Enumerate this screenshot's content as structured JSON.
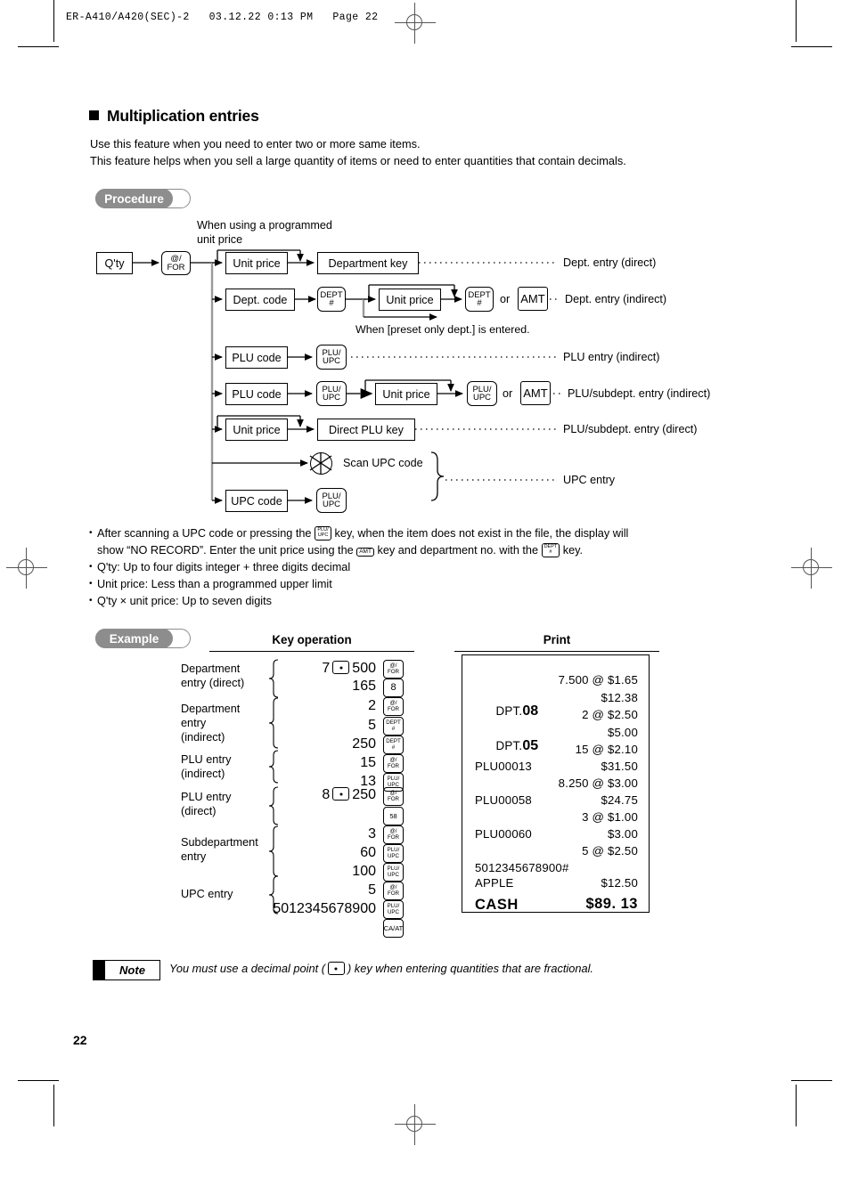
{
  "header": {
    "text": "ER-A410/A420(SEC)-2   03.12.22 0:13 PM   Page 22"
  },
  "section": {
    "title": "Multiplication entries",
    "intro_line1": "Use this feature when you need to enter two or more same items.",
    "intro_line2": "This feature helps when you sell a large quantity of items or need to enter quantities that contain decimals."
  },
  "badges": {
    "procedure": "Procedure",
    "example": "Example",
    "note": "Note"
  },
  "flowchart": {
    "caption_line1": "When using a programmed",
    "caption_line2": "unit price",
    "qty": "Q'ty",
    "key_at_for_l1": "@/",
    "key_at_for_l2": "FOR",
    "unit_price": "Unit price",
    "department_key": "Department key",
    "dept_code": "Dept. code",
    "key_dept_l1": "DEPT",
    "key_dept_l2": "#",
    "key_amt": "AMT",
    "or": "or",
    "preset_note": "When [preset only dept.] is entered.",
    "plu_code": "PLU code",
    "key_plu_l1": "PLU/",
    "key_plu_l2": "UPC",
    "direct_plu_key": "Direct PLU key",
    "scan_upc_code": "Scan UPC code",
    "upc_code": "UPC code",
    "result_dept_direct": "Dept. entry (direct)",
    "result_dept_indirect": "Dept. entry (indirect)",
    "result_plu_indirect": "PLU entry (indirect)",
    "result_plu_subdept_indirect": "PLU/subdept. entry (indirect)",
    "result_plu_subdept_direct": "PLU/subdept. entry (direct)",
    "result_upc": "UPC entry"
  },
  "bullets": [
    {
      "part1": "After scanning a UPC code or pressing the ",
      "key1_l1": "PLU/",
      "key1_l2": "UPC",
      "part2": " key, when the item does not exist in the file, the display will",
      "part3": "show “NO RECORD”.  Enter the unit price using the ",
      "key2": "AMT",
      "part4": " key and department no. with the ",
      "key3_l1": "DEPT",
      "key3_l2": "#",
      "part5": " key."
    },
    {
      "text": "Q'ty: Up to four digits integer + three digits decimal"
    },
    {
      "text": "Unit price: Less than a programmed upper limit"
    },
    {
      "text": "Q'ty × unit price: Up to seven digits"
    }
  ],
  "example": {
    "col_key_operation": "Key operation",
    "col_print": "Print",
    "rows": [
      {
        "label_l1": "Department",
        "label_l2": "entry (direct)",
        "label_l3": ""
      },
      {
        "label_l1": "Department",
        "label_l2": "entry",
        "label_l3": "(indirect)"
      },
      {
        "label_l1": "PLU entry",
        "label_l2": "(indirect)",
        "label_l3": ""
      },
      {
        "label_l1": "PLU entry",
        "label_l2": "(direct)",
        "label_l3": ""
      },
      {
        "label_l1": "Subdepartment",
        "label_l2": "entry",
        "label_l3": ""
      },
      {
        "label_l1": "UPC entry",
        "label_l2": "",
        "label_l3": ""
      }
    ],
    "operations": [
      {
        "num": "7",
        "dot": true,
        "num2": "500",
        "key_l1": "@/",
        "key_l2": "FOR",
        "key_style": "two"
      },
      {
        "num": "165",
        "dot": false,
        "num2": "",
        "key_l1": "8",
        "key_l2": "",
        "key_style": "big"
      },
      {
        "num": "2",
        "dot": false,
        "num2": "",
        "key_l1": "@/",
        "key_l2": "FOR",
        "key_style": "two"
      },
      {
        "num": "5",
        "dot": false,
        "num2": "",
        "key_l1": "DEPT",
        "key_l2": "#",
        "key_style": "two"
      },
      {
        "num": "250",
        "dot": false,
        "num2": "",
        "key_l1": "DEPT",
        "key_l2": "#",
        "key_style": "two"
      },
      {
        "num": "15",
        "dot": false,
        "num2": "",
        "key_l1": "@/",
        "key_l2": "FOR",
        "key_style": "two"
      },
      {
        "num": "13",
        "dot": false,
        "num2": "",
        "key_l1": "PLU/",
        "key_l2": "UPC",
        "key_style": "two"
      },
      {
        "num": "8",
        "dot": true,
        "num2": "250",
        "key_l1": "@/",
        "key_l2": "FOR",
        "key_style": "two"
      },
      {
        "num": "",
        "dot": false,
        "num2": "",
        "key_l1": "58",
        "key_l2": "",
        "key_style": "mid"
      },
      {
        "num": "3",
        "dot": false,
        "num2": "",
        "key_l1": "@/",
        "key_l2": "FOR",
        "key_style": "two"
      },
      {
        "num": "60",
        "dot": false,
        "num2": "",
        "key_l1": "PLU/",
        "key_l2": "UPC",
        "key_style": "two"
      },
      {
        "num": "100",
        "dot": false,
        "num2": "",
        "key_l1": "PLU/",
        "key_l2": "UPC",
        "key_style": "two"
      },
      {
        "num": "5",
        "dot": false,
        "num2": "",
        "key_l1": "@/",
        "key_l2": "FOR",
        "key_style": "two"
      },
      {
        "num": "5012345678900",
        "dot": false,
        "num2": "",
        "key_l1": "PLU/",
        "key_l2": "UPC",
        "key_style": "two"
      },
      {
        "num": "",
        "dot": false,
        "num2": "",
        "key_l1": "CA/AT",
        "key_l2": "",
        "key_style": "mid"
      }
    ]
  },
  "receipt": {
    "lines": [
      {
        "left": "",
        "right": "7.500 @ $1.65"
      },
      {
        "left": "DPT.",
        "left_bold": "08",
        "right": "$12.38"
      },
      {
        "left": "",
        "right": "2 @ $2.50"
      },
      {
        "left": "DPT.",
        "left_bold": "05",
        "right": "$5.00"
      },
      {
        "left": "",
        "right": "15 @ $2.10"
      },
      {
        "left": "PLU00013",
        "right": "$31.50"
      },
      {
        "left": "",
        "right": "8.250 @ $3.00"
      },
      {
        "left": "PLU00058",
        "right": "$24.75"
      },
      {
        "left": "",
        "right": "3 @ $1.00"
      },
      {
        "left": "PLU00060",
        "right": "$3.00"
      },
      {
        "left": "",
        "right": "5 @ $2.50"
      },
      {
        "left": "5012345678900#",
        "right": ""
      },
      {
        "left": "APPLE",
        "right": "$12.50"
      },
      {
        "left": "CASH",
        "right": "$89. 13",
        "total": true
      }
    ]
  },
  "note": {
    "text_before": "You must use a decimal point (",
    "text_after": ") key when entering quantities that are fractional."
  },
  "footer": {
    "page_number": "22"
  }
}
